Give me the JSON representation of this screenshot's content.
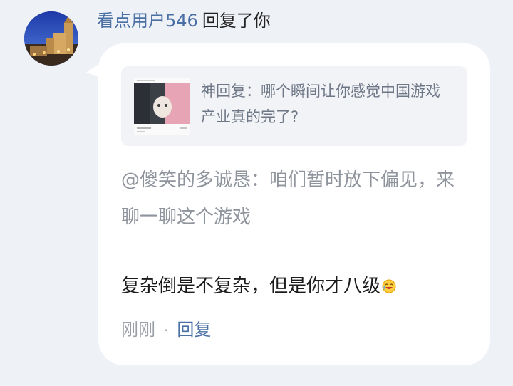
{
  "header": {
    "username": "看点用户546",
    "action": "回复了你"
  },
  "quote": {
    "text": "神回复：哪个瞬间让你感觉中国游戏产业真的完了?"
  },
  "mention": {
    "text": "@傻笑的多诚恳：咱们暂时放下偏见，来聊一聊这个游戏"
  },
  "reply": {
    "text": "复杂倒是不复杂，但是你才八级",
    "emoji": "laughing-emoji-icon"
  },
  "footer": {
    "time": "刚刚",
    "separator": "·",
    "reply_label": "回复"
  },
  "colors": {
    "username": "#4a6fa5",
    "reply_link": "#4a6fa5",
    "background": "#eef1f6",
    "card": "#ffffff"
  }
}
